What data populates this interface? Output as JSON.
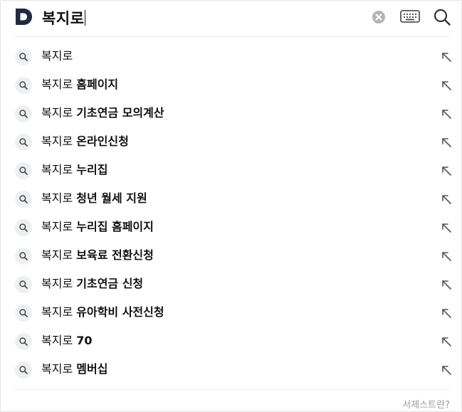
{
  "search": {
    "query": "복지로",
    "logo_icon": "daum-d-logo",
    "clear_icon": "clear-circle-icon",
    "keyboard_icon": "keyboard-icon",
    "search_icon": "search-icon"
  },
  "suggestions": [
    {
      "base": "복지로",
      "rest": ""
    },
    {
      "base": "복지로",
      "rest": "홈페이지"
    },
    {
      "base": "복지로",
      "rest": "기초연금 모의계산"
    },
    {
      "base": "복지로",
      "rest": "온라인신청"
    },
    {
      "base": "복지로",
      "rest": "누리집"
    },
    {
      "base": "복지로",
      "rest": "청년 월세 지원"
    },
    {
      "base": "복지로",
      "rest": "누리집 홈페이지"
    },
    {
      "base": "복지로",
      "rest": "보육료 전환신청"
    },
    {
      "base": "복지로",
      "rest": "기초연금 신청"
    },
    {
      "base": "복지로",
      "rest": "유아학비 사전신청"
    },
    {
      "base": "복지로",
      "rest": "70"
    },
    {
      "base": "복지로",
      "rest": "멤버십"
    }
  ],
  "footer": {
    "help_link": "서제스트란?"
  },
  "colors": {
    "logo": "#1f2a44",
    "icon_gray": "#555555",
    "clear_gray": "#b4b4b4",
    "divider": "#ebedf0",
    "row_icon_bg": "#eeeff1",
    "footer_text": "#9a9a9a"
  }
}
